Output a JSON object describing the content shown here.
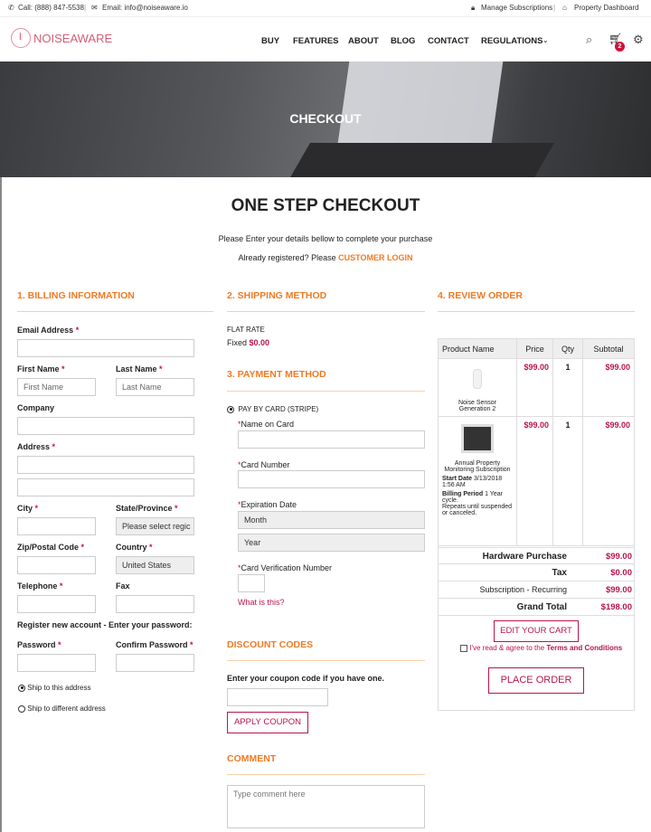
{
  "topbar": {
    "phone": "Call: (888) 847-5538",
    "email": "Email: info@noiseaware.io",
    "manage": "Manage Subscriptions",
    "dashboard": "Property Dashboard"
  },
  "nav": {
    "logo": "NOISEAWARE",
    "items": [
      "BUY",
      "FEATURES",
      "ABOUT",
      "BLOG",
      "CONTACT",
      "REGULATIONS"
    ],
    "cart_count": "2"
  },
  "hero": {
    "title": "CHECKOUT"
  },
  "page": {
    "title": "ONE STEP CHECKOUT",
    "subtitle": "Please Enter your details bellow to complete your purchase",
    "registered": "Already registered? Please",
    "login": "CUSTOMER LOGIN"
  },
  "billing": {
    "heading": "1. BILLING INFORMATION",
    "email": "Email Address",
    "first": "First Name",
    "first_ph": "First Name",
    "last": "Last Name",
    "last_ph": "Last Name",
    "company": "Company",
    "address": "Address",
    "city": "City",
    "state": "State/Province",
    "state_val": "Please select regic",
    "zip": "Zip/Postal Code",
    "country": "Country",
    "country_val": "United States",
    "tel": "Telephone",
    "fax": "Fax",
    "register": "Register new account - Enter your password:",
    "password": "Password",
    "confirm": "Confirm Password",
    "ship_same": "Ship to this address",
    "ship_diff": "Ship to different address",
    "req": "*"
  },
  "shipping": {
    "heading": "2. SHIPPING METHOD",
    "method": "FLAT RATE",
    "fixed": "Fixed",
    "price": "$0.00"
  },
  "payment": {
    "heading": "3. PAYMENT METHOD",
    "option": "PAY BY CARD (STRIPE)",
    "name": "Name on Card",
    "number": "Card Number",
    "exp": "Expiration Date",
    "month": "Month",
    "year": "Year",
    "cvv": "Card Verification Number",
    "what": "What is this?",
    "req": "*"
  },
  "discount": {
    "heading": "DISCOUNT CODES",
    "prompt": "Enter your coupon code if you have one.",
    "apply": "APPLY COUPON"
  },
  "comment": {
    "heading": "COMMENT",
    "placeholder": "Type comment here"
  },
  "review": {
    "heading": "4. REVIEW ORDER",
    "cols": [
      "Product Name",
      "Price",
      "Qty",
      "Subtotal"
    ],
    "items": [
      {
        "name": "Noise Sensor Generation 2",
        "price": "$99.00",
        "qty": "1",
        "subtotal": "$99.00"
      },
      {
        "name": "Annual Property Monitoring Subscription",
        "price": "$99.00",
        "qty": "1",
        "subtotal": "$99.00",
        "start_label": "Start Date",
        "start": "3/13/2018 1:56 AM",
        "billing_label": "Billing Period",
        "billing": "1 Year cycle.",
        "repeats": "Repeats until suspended or canceled."
      }
    ],
    "totals": [
      {
        "label": "Hardware Purchase",
        "value": "$99.00"
      },
      {
        "label": "Tax",
        "value": "$0.00"
      },
      {
        "label": "Subscription - Recurring",
        "value": "$99.00"
      },
      {
        "label": "Grand Total",
        "value": "$198.00"
      }
    ],
    "edit": "EDIT YOUR CART",
    "agree": "I've read & agree to the",
    "terms": "Terms and Conditions",
    "place": "PLACE ORDER"
  }
}
